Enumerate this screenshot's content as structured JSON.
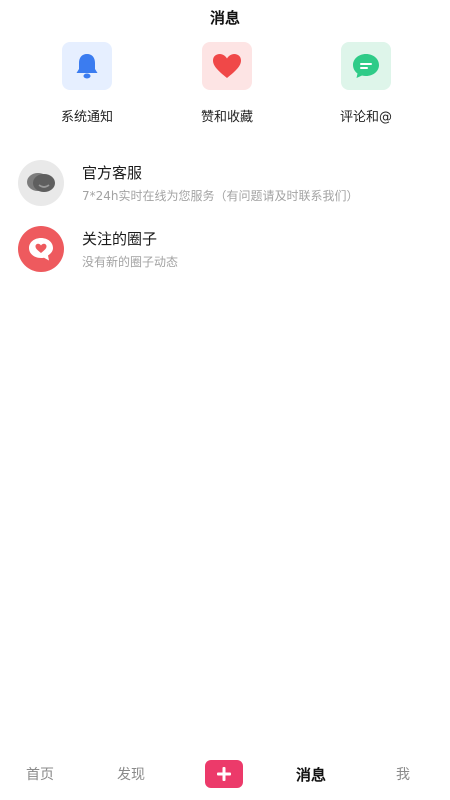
{
  "header": {
    "title": "消息"
  },
  "categories": [
    {
      "label": "系统通知",
      "icon": "bell-icon",
      "bg": "#e6efff",
      "color": "#3b7cf0"
    },
    {
      "label": "赞和收藏",
      "icon": "heart-icon",
      "bg": "#fde4e4",
      "color": "#f04848"
    },
    {
      "label": "评论和@",
      "icon": "chat-bubble-icon",
      "bg": "#def5ea",
      "color": "#2fcb88"
    }
  ],
  "messages": [
    {
      "title": "官方客服",
      "subtitle": "7*24h实时在线为您服务（有问题请及时联系我们）",
      "avatar": "customer-service-icon"
    },
    {
      "title": "关注的圈子",
      "subtitle": "没有新的圈子动态",
      "avatar": "heart-bubble-icon"
    }
  ],
  "tabbar": {
    "home": "首页",
    "discover": "发现",
    "add": "+",
    "messages": "消息",
    "me": "我",
    "active": "消息",
    "accent": "#ec3a6a"
  }
}
